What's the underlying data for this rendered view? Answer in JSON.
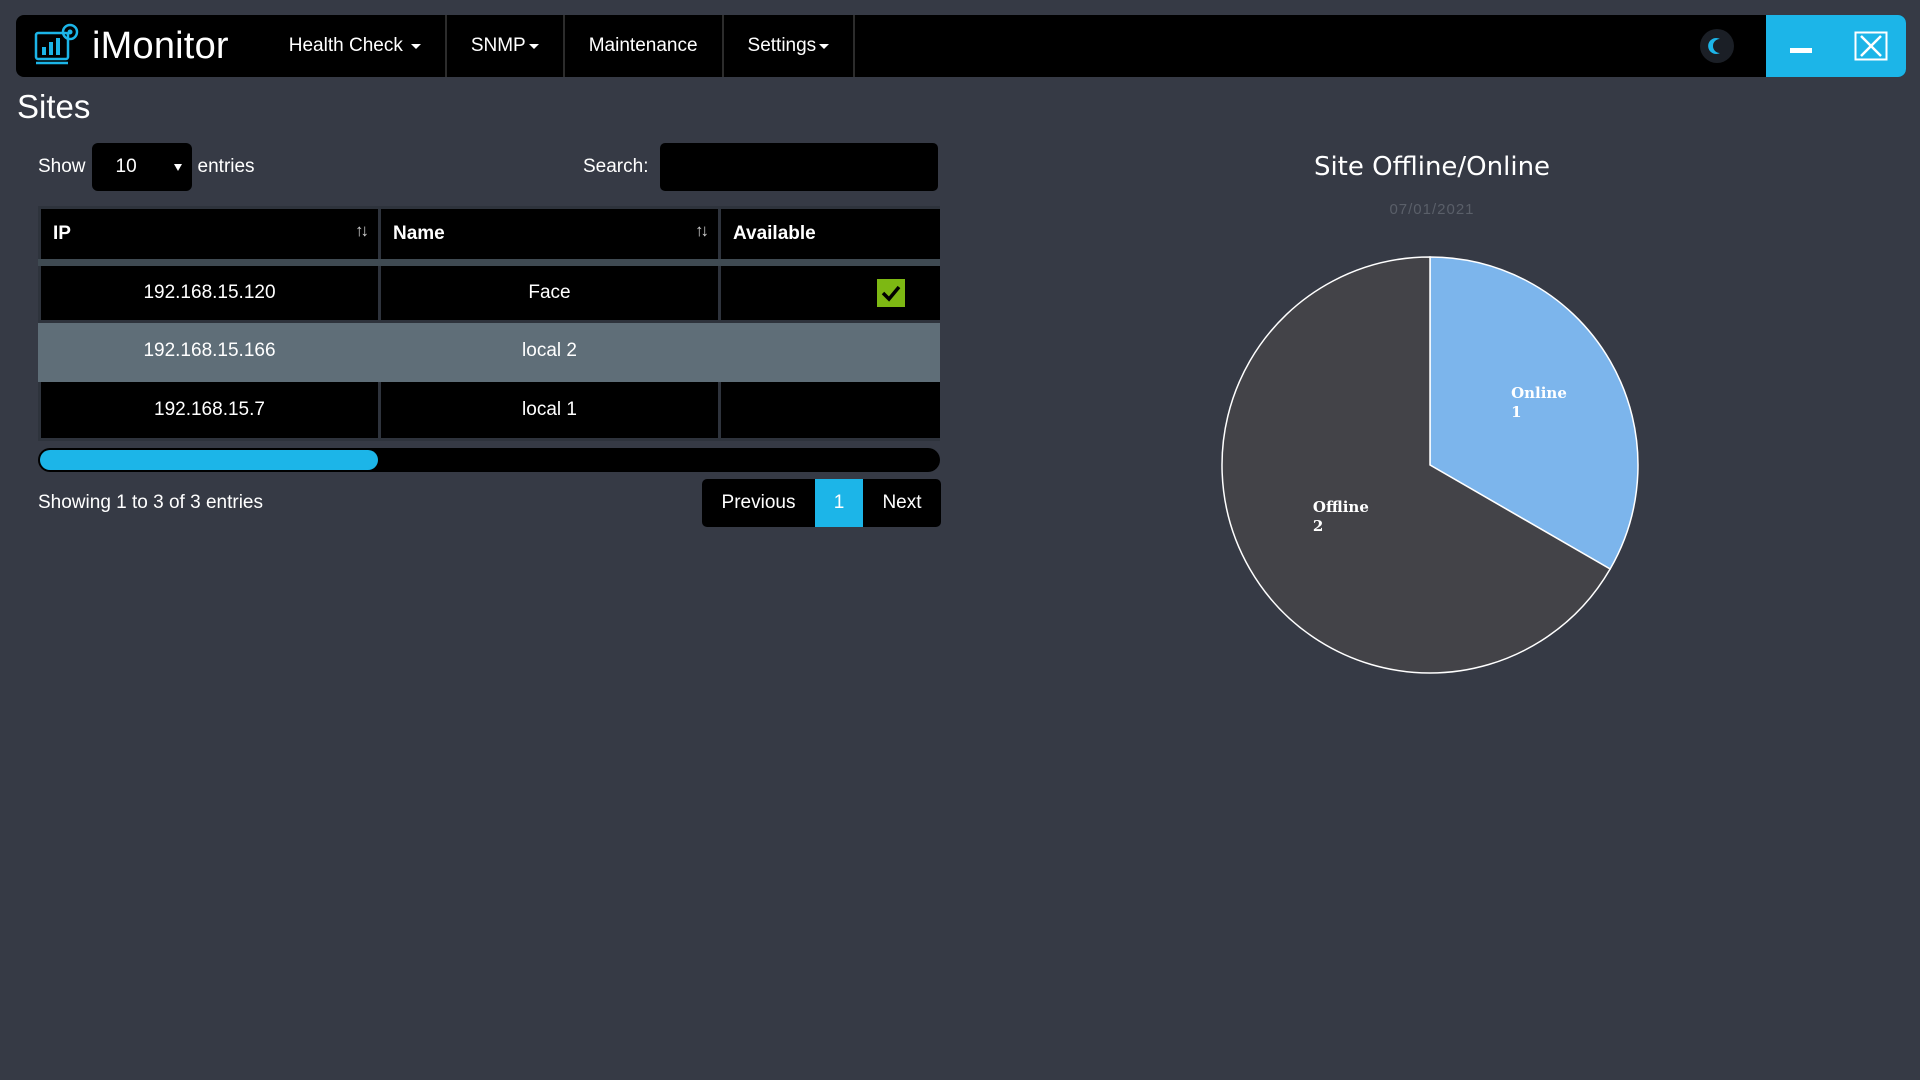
{
  "app": {
    "name": "iMonitor"
  },
  "nav": {
    "items": [
      {
        "label": "Health Check",
        "dropdown": true
      },
      {
        "label": "SNMP",
        "dropdown": true
      },
      {
        "label": "Maintenance",
        "dropdown": false
      },
      {
        "label": "Settings",
        "dropdown": true
      }
    ]
  },
  "page": {
    "title": "Sites"
  },
  "table_controls": {
    "show_label": "Show",
    "entries_value": "10",
    "entries_label": "entries",
    "search_label": "Search:",
    "search_value": ""
  },
  "table": {
    "columns": [
      "IP",
      "Name",
      "Available"
    ],
    "rows": [
      {
        "ip": "192.168.15.120",
        "name": "Face",
        "available": true
      },
      {
        "ip": "192.168.15.166",
        "name": "local 2",
        "available": false
      },
      {
        "ip": "192.168.15.7",
        "name": "local 1",
        "available": false
      }
    ]
  },
  "footer": {
    "info": "Showing 1 to 3 of 3 entries",
    "previous": "Previous",
    "page": "1",
    "next": "Next"
  },
  "colors": {
    "accent": "#1cb5e8",
    "check": "#7db813",
    "online": "#7cb5ec",
    "offline": "#434348"
  },
  "chart_data": {
    "type": "pie",
    "title": "Site Offline/Online",
    "subtitle": "07/01/2021",
    "slices": [
      {
        "label": "Online",
        "value": 1,
        "color": "#7cb5ec"
      },
      {
        "label": "Offline",
        "value": 2,
        "color": "#434348"
      }
    ]
  }
}
